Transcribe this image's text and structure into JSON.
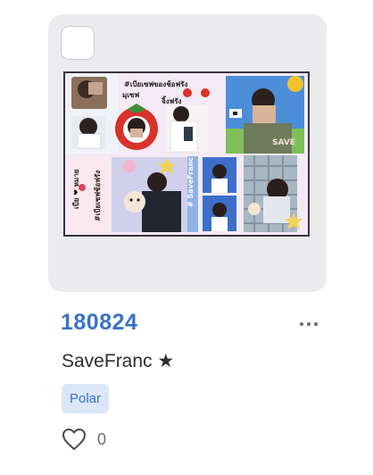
{
  "item": {
    "title": "180824",
    "subtitle": "SaveFranc ★",
    "badge": "Polar",
    "likes_count": "0"
  },
  "artwork": {
    "text_line1": "#เบียเซฟของช้อฟรัง",
    "text_line2": "มุเซฟ",
    "text_line3": "จิ้งฟรัง",
    "vertical_text1": "เบีย ❤ หมาย",
    "vertical_text2": "#เบียเซฟช้อฟรัง",
    "vertical_text3": "# SaveFranc",
    "shirt_text": "SAVE"
  },
  "icons": {
    "select": "checkbox",
    "more": "more-horizontal-icon",
    "like": "heart-outline-icon"
  },
  "colors": {
    "accent": "#3a72c9",
    "badge_bg": "#dbe7f8",
    "card_bg": "#ececef"
  }
}
